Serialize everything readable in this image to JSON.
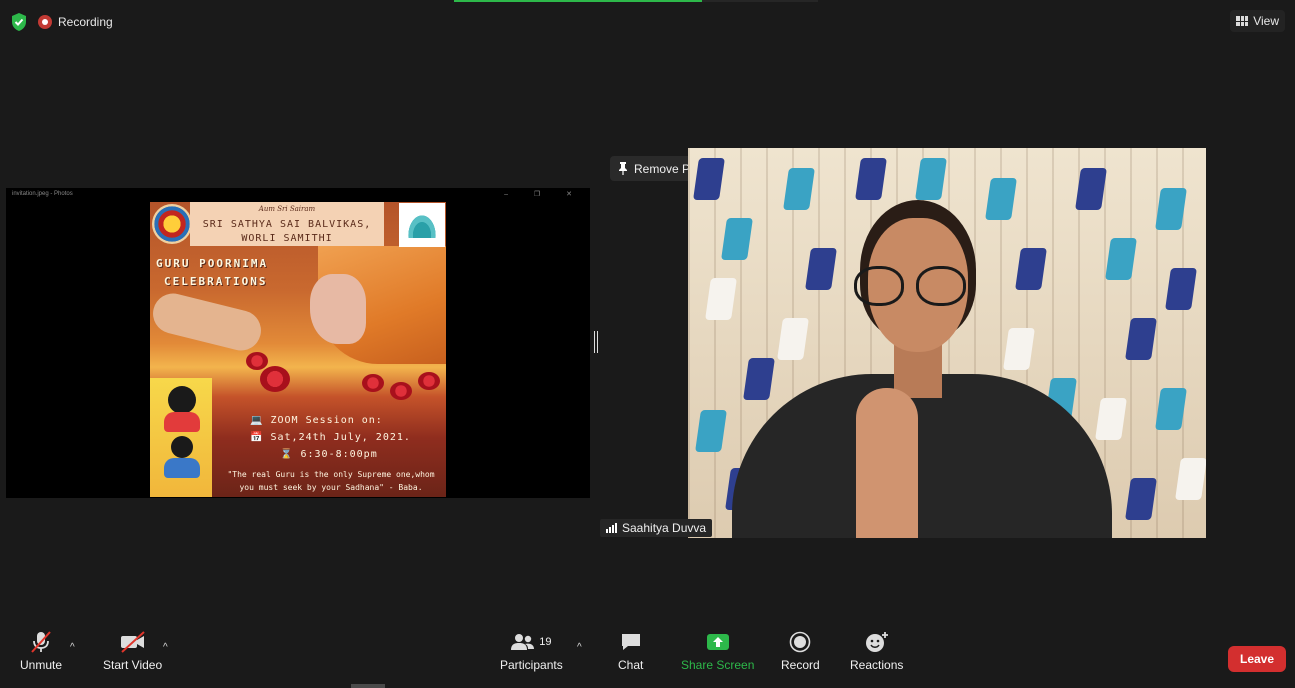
{
  "topbar": {
    "recording_label": "Recording",
    "view_label": "View",
    "progress": 0.68,
    "colors": {
      "accent": "#2db84a",
      "recording": "#c23a34"
    }
  },
  "shared_screen": {
    "window_title": "invitation.jpeg - Photos",
    "window_controls": "– ❐ ✕",
    "poster": {
      "top_line": "Aum Sri Sairam",
      "org_line1": "SRI SATHYA SAI BALVIKAS,",
      "org_line2": "WORLI SAMITHI",
      "event_line1": "GURU POORNIMA",
      "event_line2": "CELEBRATIONS",
      "session": "ZOOM Session on:",
      "date": "Sat,24th July, 2021.",
      "time": "6:30-8:00pm",
      "quote_line1": "\"The real Guru is the only Supreme one,whom",
      "quote_line2": "you must seek by your Sadhana\" - Baba."
    }
  },
  "participant": {
    "remove_pin_label": "Remove Pin",
    "name": "Saahitya Duvva"
  },
  "toolbar": {
    "unmute_label": "Unmute",
    "start_video_label": "Start Video",
    "participants_label": "Participants",
    "participants_count": "19",
    "chat_label": "Chat",
    "share_screen_label": "Share Screen",
    "record_label": "Record",
    "reactions_label": "Reactions",
    "leave_label": "Leave",
    "caret": "^",
    "colors": {
      "share": "#2db84a",
      "leave": "#d32f2f"
    }
  }
}
